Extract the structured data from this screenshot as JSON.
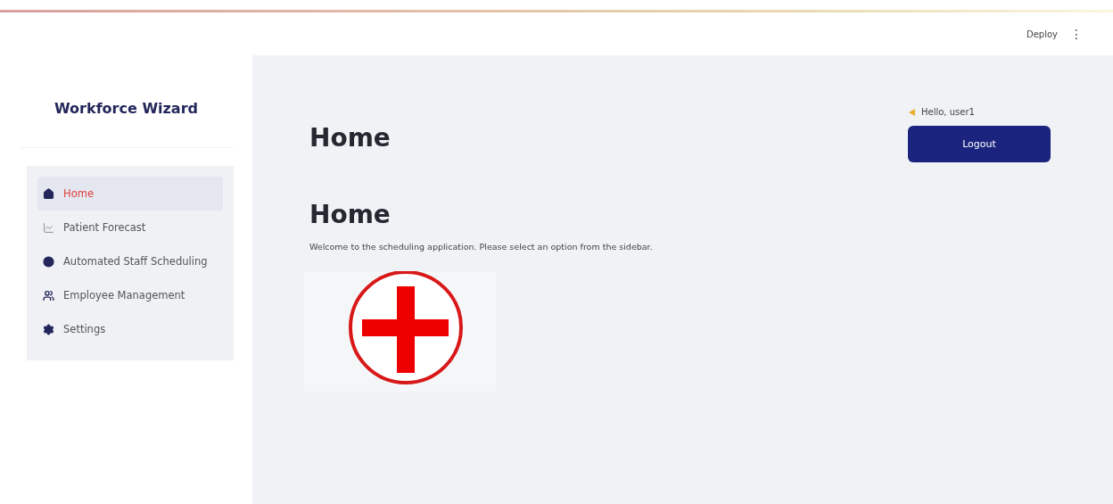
{
  "header": {
    "deploy": "Deploy",
    "menu": "⋮"
  },
  "sidebar": {
    "title": "Workforce Wizard",
    "items": [
      {
        "label": "Home",
        "selected": true
      },
      {
        "label": "Patient Forecast",
        "selected": false
      },
      {
        "label": "Automated Staff Scheduling",
        "selected": false
      },
      {
        "label": "Employee Management",
        "selected": false
      },
      {
        "label": "Settings",
        "selected": false
      }
    ]
  },
  "page": {
    "title": "Home",
    "greeting": "Hello, user1",
    "logout": "Logout",
    "heading": "Home",
    "welcome": "Welcome to the scheduling application. Please select an option from the sidebar."
  }
}
